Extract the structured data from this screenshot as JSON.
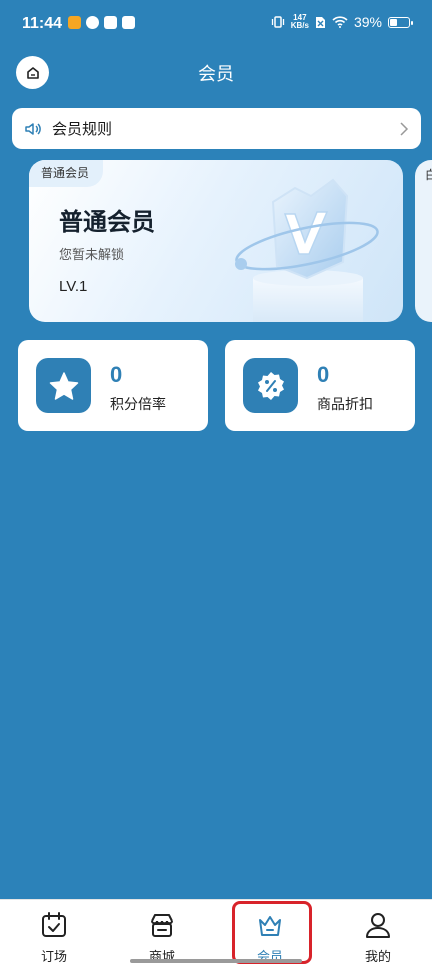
{
  "status_bar": {
    "time": "11:44",
    "net_speed_value": "147",
    "net_speed_unit": "KB/s",
    "battery": "39%"
  },
  "header": {
    "title": "会员",
    "home_icon": "home-icon"
  },
  "rules": {
    "label": "会员规则",
    "icon": "speaker-icon",
    "chevron": "chevron-right-icon"
  },
  "member_card": {
    "tag": "普通会员",
    "name": "普通会员",
    "status": "您暂未解锁",
    "level": "LV.1",
    "badge_icon": "v-shield-icon"
  },
  "next_card": {
    "tag": "白"
  },
  "stats": [
    {
      "value": "0",
      "label": "积分倍率",
      "icon": "star-icon"
    },
    {
      "value": "0",
      "label": "商品折扣",
      "icon": "discount-icon"
    }
  ],
  "tabs": [
    {
      "label": "订场",
      "icon": "calendar-check-icon",
      "active": false
    },
    {
      "label": "商城",
      "icon": "store-icon",
      "active": false
    },
    {
      "label": "会员",
      "icon": "crown-icon",
      "active": true
    },
    {
      "label": "我的",
      "icon": "user-icon",
      "active": false
    }
  ],
  "colors": {
    "background": "#2c82b9",
    "accent": "#2f80b5",
    "highlight": "#d8232a"
  }
}
